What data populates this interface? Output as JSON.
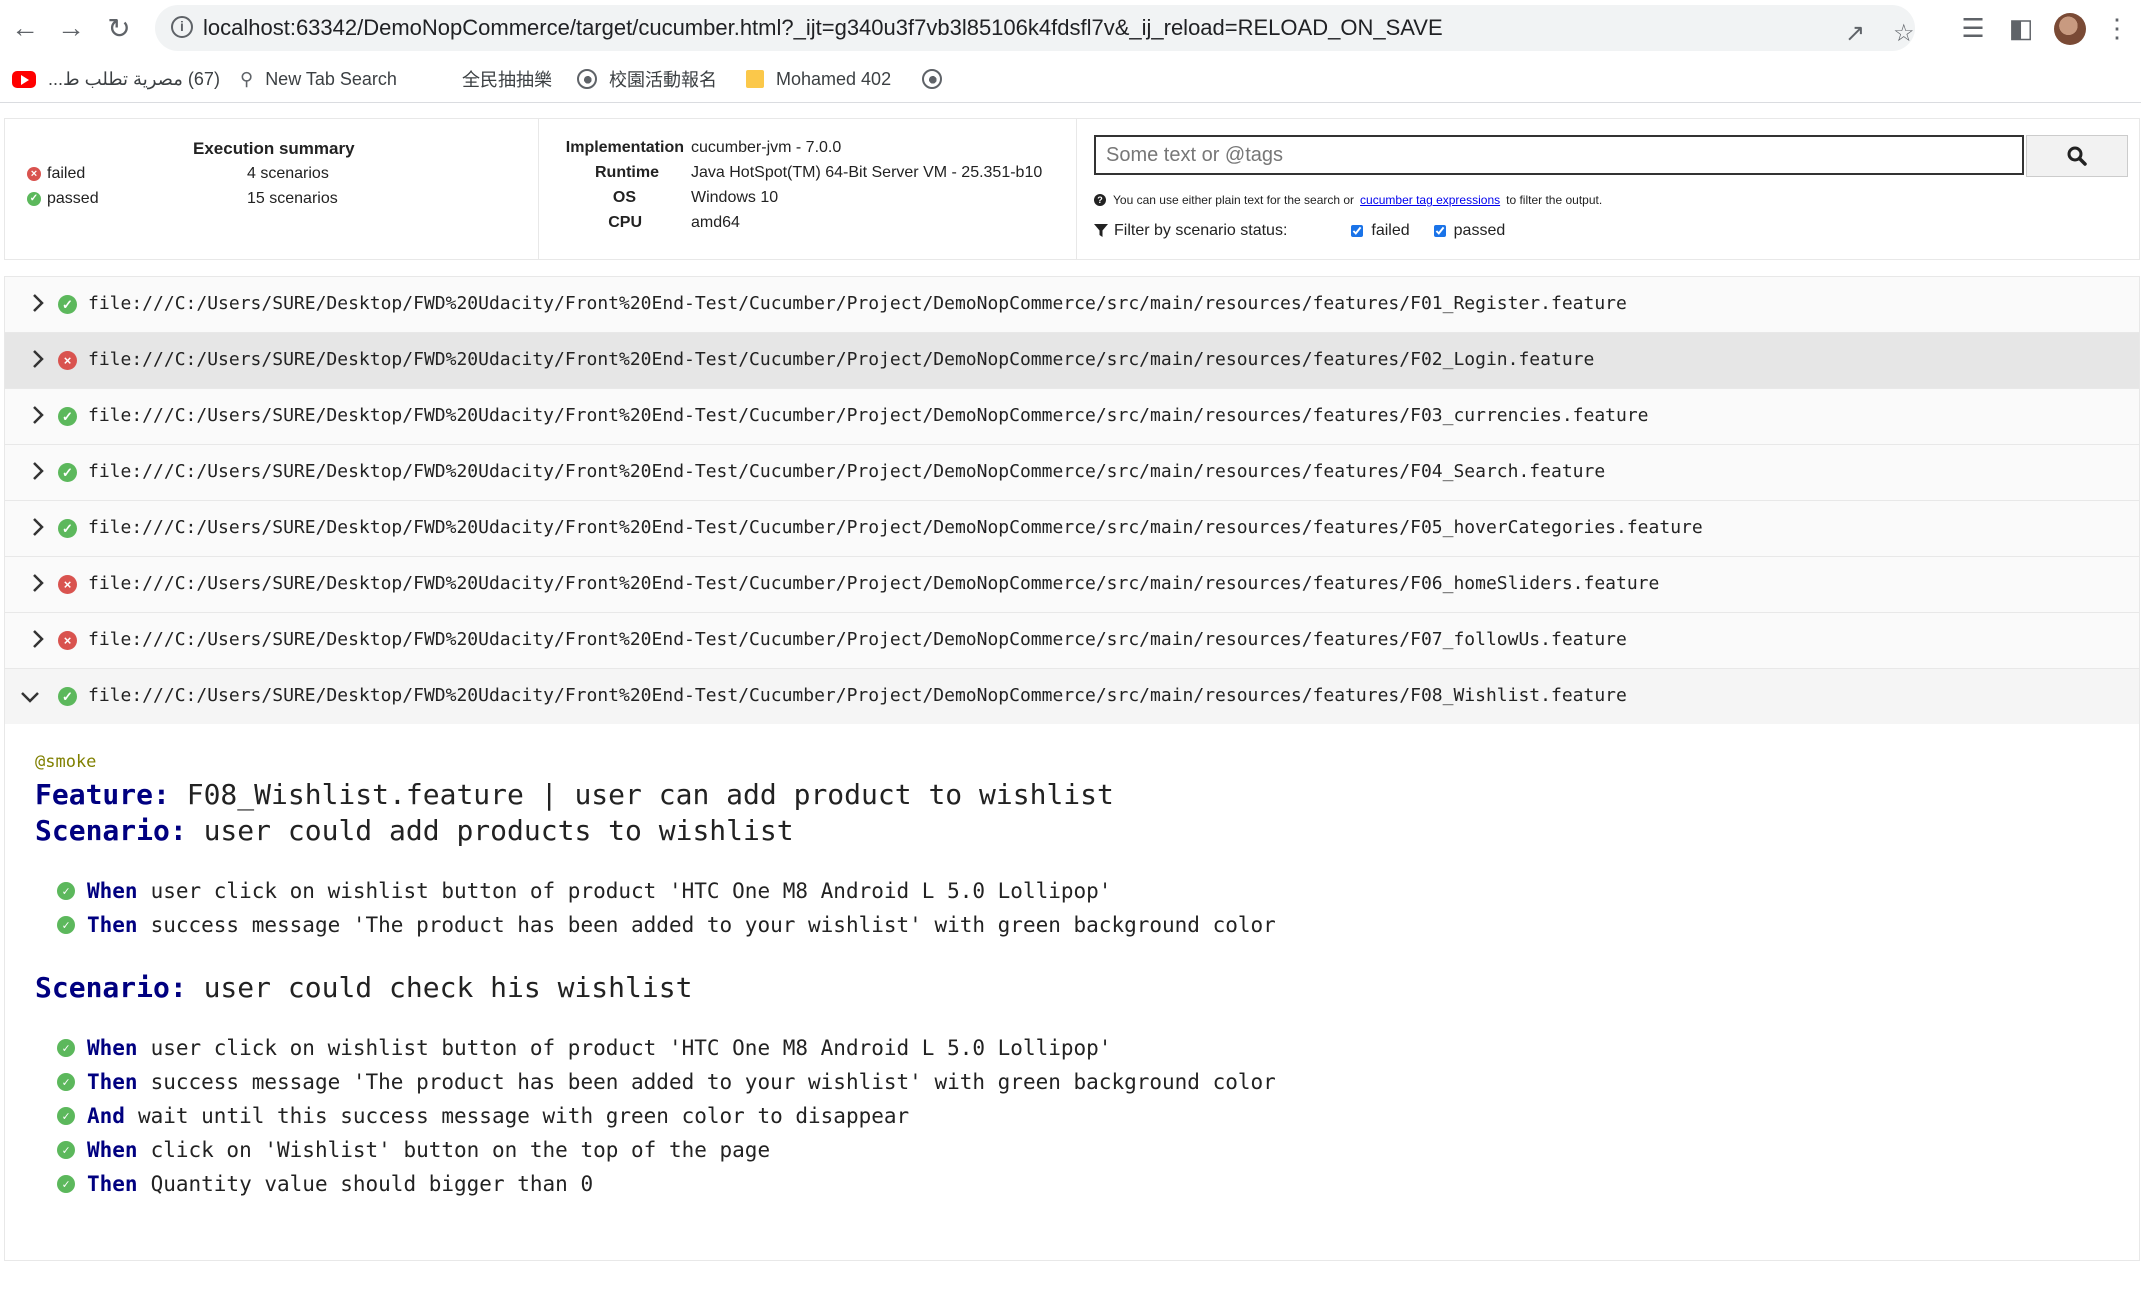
{
  "browser": {
    "url": "localhost:63342/DemoNopCommerce/target/cucumber.html?_ijt=g340u3f7vb3l85106k4fdsfl7v&_ij_reload=RELOAD_ON_SAVE",
    "bookmarks": [
      {
        "label": "(67) مصرية تطلب ط...",
        "icon": "youtube-icon"
      },
      {
        "label": "New Tab Search",
        "icon": "search-icon"
      },
      {
        "label": "全民抽抽樂",
        "icon": "none"
      },
      {
        "label": "校園活動報名",
        "icon": "globe-icon"
      },
      {
        "label": "Mohamed 402",
        "icon": "folder-icon"
      },
      {
        "label": "",
        "icon": "globe-icon"
      }
    ]
  },
  "summary": {
    "title": "Execution summary",
    "failed_label": "failed",
    "failed_count": "4 scenarios",
    "passed_label": "passed",
    "passed_count": "15 scenarios"
  },
  "environment": {
    "implementation_key": "Implementation",
    "implementation_val": "cucumber-jvm - 7.0.0",
    "runtime_key": "Runtime",
    "runtime_val": "Java HotSpot(TM) 64-Bit Server VM - 25.351-b10",
    "os_key": "OS",
    "os_val": "Windows 10",
    "cpu_key": "CPU",
    "cpu_val": "amd64"
  },
  "search": {
    "placeholder": "Some text or @tags",
    "help_prefix": "You can use either plain text for the search or",
    "help_link": "cucumber tag expressions",
    "help_suffix": "to filter the output.",
    "filter_label": "Filter by scenario status:",
    "filter_failed": "failed",
    "filter_passed": "passed"
  },
  "features": [
    {
      "status": "passed",
      "uri": "file:///C:/Users/SURE/Desktop/FWD%20Udacity/Front%20End-Test/Cucumber/Project/DemoNopCommerce/src/main/resources/features/F01_Register.feature"
    },
    {
      "status": "failed",
      "uri": "file:///C:/Users/SURE/Desktop/FWD%20Udacity/Front%20End-Test/Cucumber/Project/DemoNopCommerce/src/main/resources/features/F02_Login.feature"
    },
    {
      "status": "passed",
      "uri": "file:///C:/Users/SURE/Desktop/FWD%20Udacity/Front%20End-Test/Cucumber/Project/DemoNopCommerce/src/main/resources/features/F03_currencies.feature"
    },
    {
      "status": "passed",
      "uri": "file:///C:/Users/SURE/Desktop/FWD%20Udacity/Front%20End-Test/Cucumber/Project/DemoNopCommerce/src/main/resources/features/F04_Search.feature"
    },
    {
      "status": "passed",
      "uri": "file:///C:/Users/SURE/Desktop/FWD%20Udacity/Front%20End-Test/Cucumber/Project/DemoNopCommerce/src/main/resources/features/F05_hoverCategories.feature"
    },
    {
      "status": "failed",
      "uri": "file:///C:/Users/SURE/Desktop/FWD%20Udacity/Front%20End-Test/Cucumber/Project/DemoNopCommerce/src/main/resources/features/F06_homeSliders.feature"
    },
    {
      "status": "failed",
      "uri": "file:///C:/Users/SURE/Desktop/FWD%20Udacity/Front%20End-Test/Cucumber/Project/DemoNopCommerce/src/main/resources/features/F07_followUs.feature"
    },
    {
      "status": "passed",
      "uri": "file:///C:/Users/SURE/Desktop/FWD%20Udacity/Front%20End-Test/Cucumber/Project/DemoNopCommerce/src/main/resources/features/F08_Wishlist.feature"
    }
  ],
  "expanded": {
    "tag": "@smoke",
    "feature_kw": "Feature:",
    "feature_name": "F08_Wishlist.feature | user can add product to wishlist",
    "scenarios": [
      {
        "kw": "Scenario:",
        "name": "user could add products to wishlist",
        "steps": [
          {
            "kw": "When",
            "text": "user click on wishlist button of product 'HTC One M8 Android L 5.0 Lollipop'"
          },
          {
            "kw": "Then",
            "text": "success message 'The product has been added to your wishlist' with green background color"
          }
        ]
      },
      {
        "kw": "Scenario:",
        "name": "user could check his wishlist",
        "steps": [
          {
            "kw": "When",
            "text": "user click on wishlist button of product 'HTC One M8 Android L 5.0 Lollipop'"
          },
          {
            "kw": "Then",
            "text": "success message 'The product has been added to your wishlist' with green background color"
          },
          {
            "kw": "And",
            "text": "wait until this success message with green color to disappear"
          },
          {
            "kw": "When",
            "text": "click on 'Wishlist' button on the top of the page"
          },
          {
            "kw": "Then",
            "text": "Quantity value should bigger than 0"
          }
        ]
      }
    ]
  }
}
